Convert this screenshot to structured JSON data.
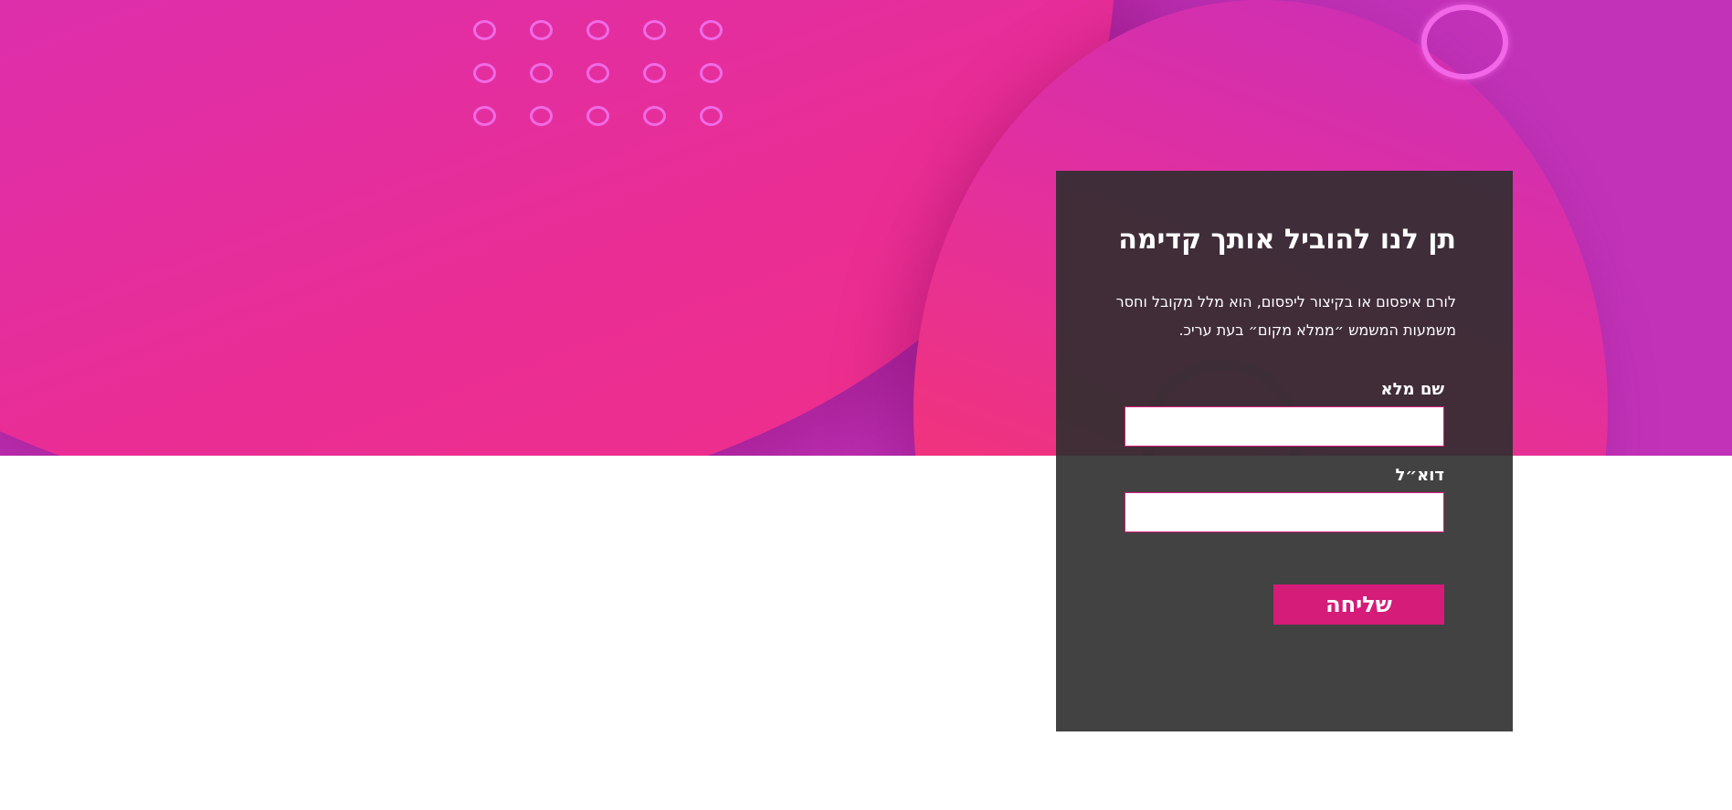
{
  "colors": {
    "accent": "#d41c78",
    "hero_pink": "#ea2d93",
    "hero_purple": "#c132b8",
    "card_bg": "#2d2d2d"
  },
  "form": {
    "title": "תן לנו להוביל אותך קדימה",
    "description": "לורם איפסום או בקיצור ליפסום, הוא מלל מקובל וחסר משמעות המשמש ״ממלא מקום״ בעת עריכ.",
    "name_label": "שם מלא",
    "name_value": "",
    "email_label": "דוא״ל",
    "email_value": "",
    "submit_label": "שליחה"
  }
}
